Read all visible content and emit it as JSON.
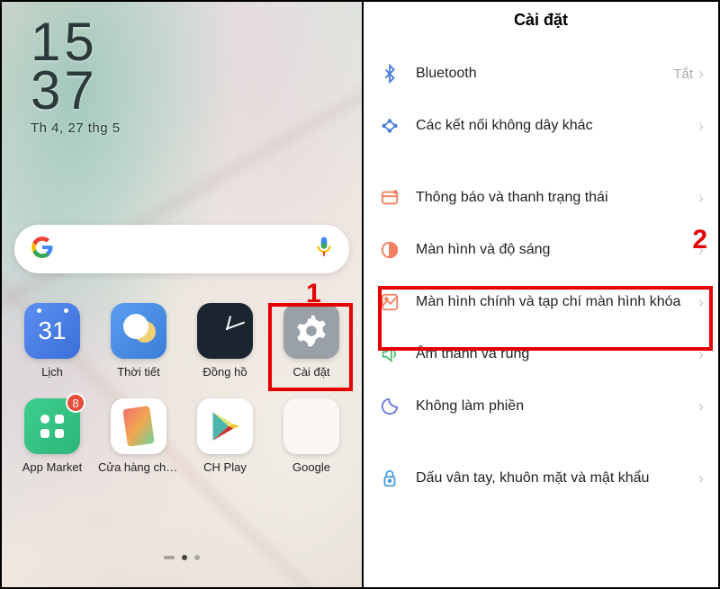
{
  "homescreen": {
    "clock": {
      "line1": "15",
      "line2": "37",
      "date": "Th 4, 27 thg 5"
    },
    "apps": [
      {
        "label": "Lịch",
        "id": "calendar",
        "day": "31"
      },
      {
        "label": "Thời tiết",
        "id": "weather"
      },
      {
        "label": "Đồng hồ",
        "id": "clock"
      },
      {
        "label": "Cài đặt",
        "id": "settings"
      },
      {
        "label": "App Market",
        "id": "market",
        "badge": "8"
      },
      {
        "label": "Cửa hàng chủ đề",
        "id": "theme"
      },
      {
        "label": "CH Play",
        "id": "play"
      },
      {
        "label": "Google",
        "id": "google-folder"
      }
    ]
  },
  "settings": {
    "title": "Cài đặt",
    "items": [
      {
        "icon": "bluetooth",
        "label": "Bluetooth",
        "value": "Tắt",
        "color": "#4a7de0"
      },
      {
        "icon": "wireless",
        "label": "Các kết nối không dây khác",
        "color": "#4a7de0"
      },
      {
        "gap": true
      },
      {
        "icon": "notification",
        "label": "Thông báo và thanh trạng thái",
        "color": "#f08060"
      },
      {
        "icon": "display",
        "label": "Màn hình và độ sáng",
        "color": "#f08060"
      },
      {
        "icon": "home",
        "label": "Màn hình chính và tạp chí màn hình khóa",
        "color": "#f08060"
      },
      {
        "icon": "sound",
        "label": "Âm thanh và rung",
        "color": "#50c070"
      },
      {
        "icon": "dnd",
        "label": "Không làm phiền",
        "color": "#6878e0"
      },
      {
        "gap": true
      },
      {
        "icon": "fingerprint",
        "label": "Dấu vân tay, khuôn mặt và mật khẩu",
        "color": "#4a9de0"
      }
    ]
  },
  "annotations": {
    "num1": "1",
    "num2": "2"
  }
}
